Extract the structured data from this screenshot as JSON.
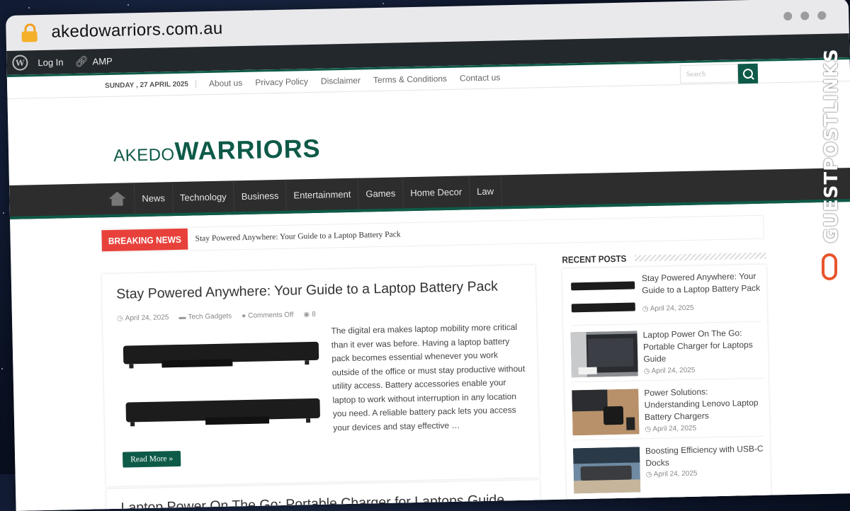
{
  "browser": {
    "url": "akedowarriors.com.au"
  },
  "admin_bar": {
    "login": "Log In",
    "amp": "AMP"
  },
  "top_nav": {
    "date": "SUNDAY , 27 APRIL 2025",
    "links": [
      "About us",
      "Privacy Policy",
      "Disclaimer",
      "Terms & Conditions",
      "Contact us"
    ],
    "search_placeholder": "Search"
  },
  "logo": {
    "prefix": "AKEDO",
    "main": "WARRIORS"
  },
  "main_nav": {
    "items": [
      "News",
      "Technology",
      "Business",
      "Entertainment",
      "Games",
      "Home Decor",
      "Law"
    ]
  },
  "breaking_news": {
    "label": "Breaking News",
    "headline": "Stay Powered Anywhere: Your Guide to a Laptop Battery Pack"
  },
  "article": {
    "title": "Stay Powered Anywhere: Your Guide to a Laptop Battery Pack",
    "date": "April 24, 2025",
    "category": "Tech Gadgets",
    "comments": "Comments Off",
    "views": "8",
    "excerpt": "The digital era makes laptop mobility more critical than it ever was before. Having a laptop battery pack becomes essential whenever you work outside of the office or must stay productive without utility access. Battery accessories enable your laptop to work without interruption in any location you need. A reliable battery pack lets you access your devices and stay effective …",
    "read_more": "Read More »"
  },
  "article2": {
    "title": "Laptop Power On The Go: Portable Charger for Laptops Guide"
  },
  "sidebar": {
    "title": "Recent Posts",
    "posts": [
      {
        "title": "Stay Powered Anywhere: Your Guide to a Laptop Battery Pack",
        "date": "April 24, 2025"
      },
      {
        "title": "Laptop Power On The Go: Portable Charger for Laptops Guide",
        "date": "April 24, 2025"
      },
      {
        "title": "Power Solutions: Understanding Lenovo Laptop Battery Chargers",
        "date": "April 24, 2025"
      },
      {
        "title": "Boosting Efficiency with USB-C Docks",
        "date": "April 24, 2025"
      }
    ]
  },
  "watermark": {
    "text": "GUESTPOSTLINKS"
  },
  "colors": {
    "brand_green": "#0e5a48",
    "breaking_red": "#e8413b",
    "nav_dark": "#2d2d2d",
    "admin_dark": "#23282d"
  }
}
